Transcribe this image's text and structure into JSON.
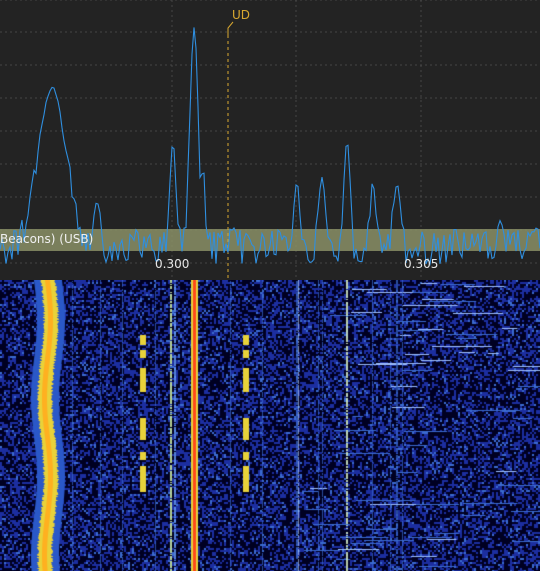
{
  "spectrum": {
    "frequency_ticks": [
      "0.300",
      "0.305"
    ],
    "marker_label": "UD",
    "band_label": "Beacons) (USB)",
    "colors": {
      "background": "#232323",
      "grid": "#5a5a5a",
      "trace": "#2f8fe0",
      "band": "#8a8f66",
      "marker": "#d9a830"
    }
  },
  "waterfall": {
    "colors": {
      "background": "#000022",
      "noise": "#1c2ea0",
      "mid": "#3b6bd0",
      "hot": "#e8d23a",
      "peak": "#ff4a1a"
    }
  }
}
